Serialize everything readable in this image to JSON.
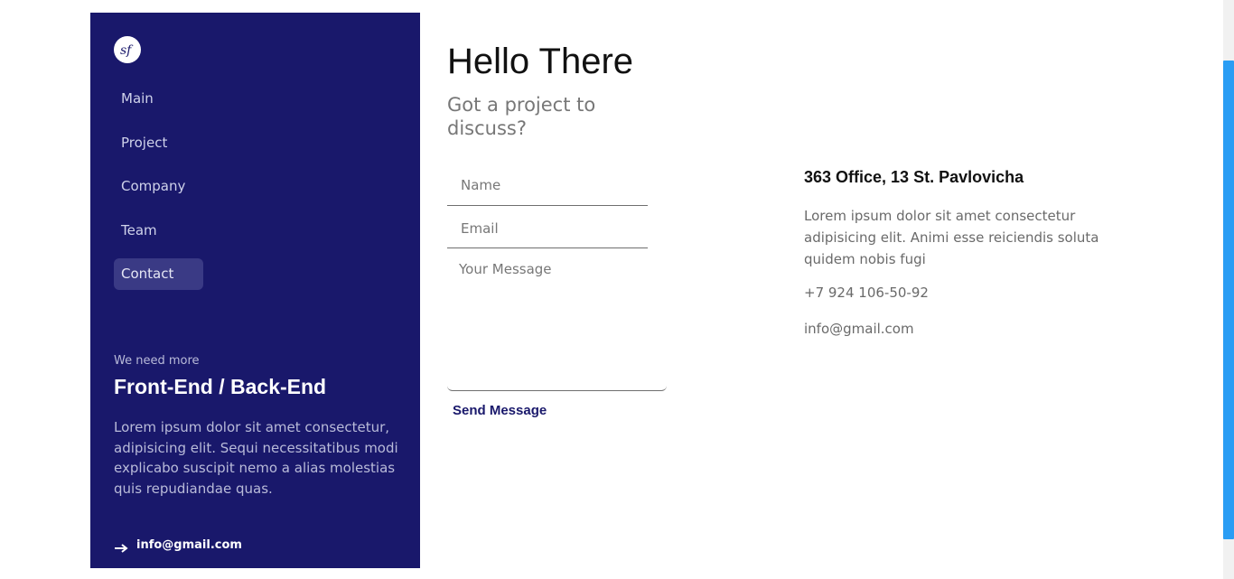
{
  "sidebar": {
    "logo_icon": "symfony-logo-icon",
    "items": [
      {
        "label": "Main"
      },
      {
        "label": "Project"
      },
      {
        "label": "Company"
      },
      {
        "label": "Team"
      },
      {
        "label": "Contact"
      }
    ],
    "active_item": "Contact",
    "promo": {
      "kicker": "We need more",
      "title": "Front-End / Back-End",
      "text": "Lorem ipsum dolor sit amet consectetur, adipisicing elit. Sequi necessitatibus modi explicabo suscipit nemo a alias molestias quis repudiandae quas.",
      "email": "info@gmail.com",
      "email_icon": "arrow-right-icon"
    },
    "background": "#19186b"
  },
  "main": {
    "title": "Hello There",
    "subtitle": "Got a project to discuss?",
    "form": {
      "name_placeholder": "Name",
      "email_placeholder": "Email",
      "message_placeholder": "Your Message",
      "send_label": "Send Message"
    }
  },
  "contact_info": {
    "address": "363 Office, 13 St. Pavlovicha",
    "description": "Lorem ipsum dolor sit amet consectetur adipisicing elit. Animi esse reiciendis soluta quidem nobis fugi",
    "phone": "+7 924 106-50-92",
    "email": "info@gmail.com"
  },
  "colors": {
    "accent": "#19186b",
    "scrollbar": "#2a9df4"
  }
}
